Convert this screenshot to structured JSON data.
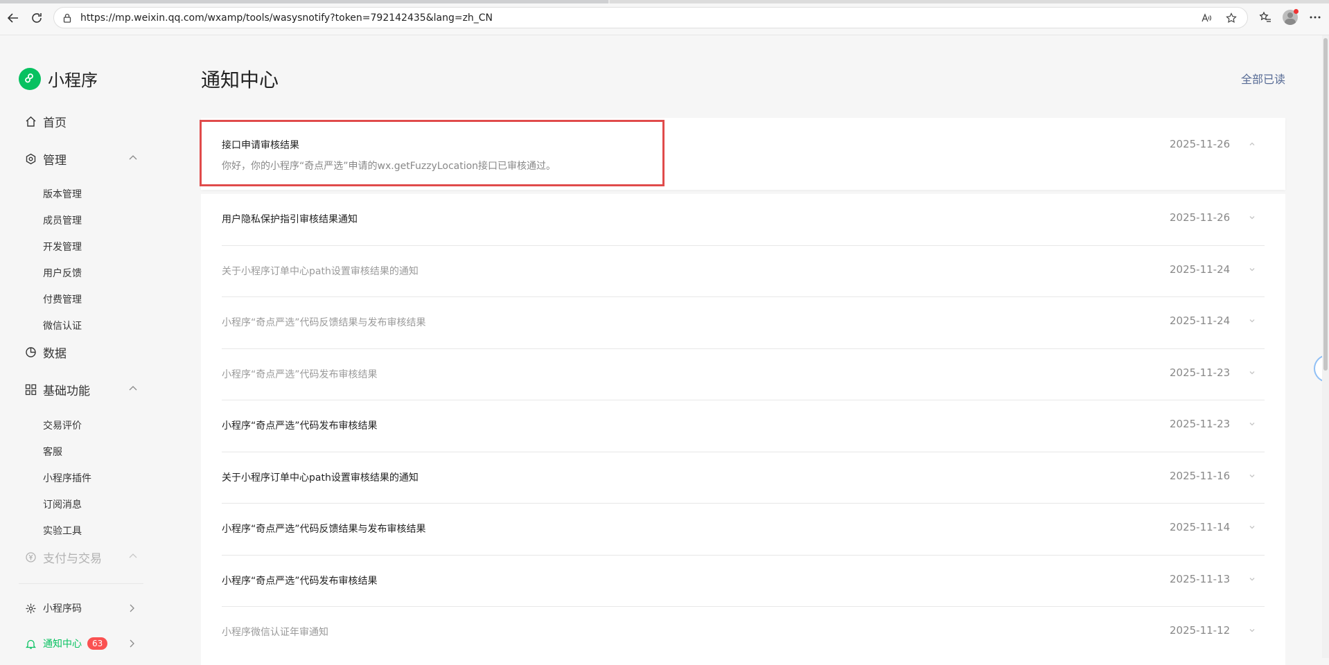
{
  "browser": {
    "url": "https://mp.weixin.qq.com/wxamp/tools/wasysnotify?token=792142435&lang=zh_CN"
  },
  "sidebar": {
    "logo_text": "小程序",
    "home": "首页",
    "manage": {
      "label": "管理",
      "items": [
        "版本管理",
        "成员管理",
        "开发管理",
        "用户反馈",
        "付费管理",
        "微信认证"
      ]
    },
    "data": "数据",
    "basic": {
      "label": "基础功能",
      "items": [
        "交易评价",
        "客服",
        "小程序插件",
        "订阅消息",
        "实验工具"
      ]
    },
    "payment": "支付与交易",
    "qrcode": "小程序码",
    "notify": {
      "label": "通知中心",
      "badge": "63"
    }
  },
  "main": {
    "title": "通知中心",
    "mark_all_read": "全部已读",
    "expanded": {
      "title": "接口申请审核结果",
      "date": "2025-11-26",
      "content": "你好，你的小程序“奇点严选”申请的wx.getFuzzyLocation接口已审核通过。"
    },
    "notifications": [
      {
        "title": "用户隐私保护指引审核结果通知",
        "date": "2025-11-26",
        "read": false
      },
      {
        "title": "关于小程序订单中心path设置审核结果的通知",
        "date": "2025-11-24",
        "read": true
      },
      {
        "title": "小程序“奇点严选”代码反馈结果与发布审核结果",
        "date": "2025-11-24",
        "read": true
      },
      {
        "title": "小程序“奇点严选”代码发布审核结果",
        "date": "2025-11-23",
        "read": true
      },
      {
        "title": "小程序“奇点严选”代码发布审核结果",
        "date": "2025-11-23",
        "read": false
      },
      {
        "title": "关于小程序订单中心path设置审核结果的通知",
        "date": "2025-11-16",
        "read": false
      },
      {
        "title": "小程序“奇点严选”代码反馈结果与发布审核结果",
        "date": "2025-11-14",
        "read": false
      },
      {
        "title": "小程序“奇点严选”代码发布审核结果",
        "date": "2025-11-13",
        "read": false
      },
      {
        "title": "小程序微信认证年审通知",
        "date": "2025-11-12",
        "read": true
      }
    ]
  },
  "colors": {
    "accent": "#07c160",
    "link": "#576b95",
    "badge": "#fa5151",
    "highlight": "#e04b4b"
  }
}
